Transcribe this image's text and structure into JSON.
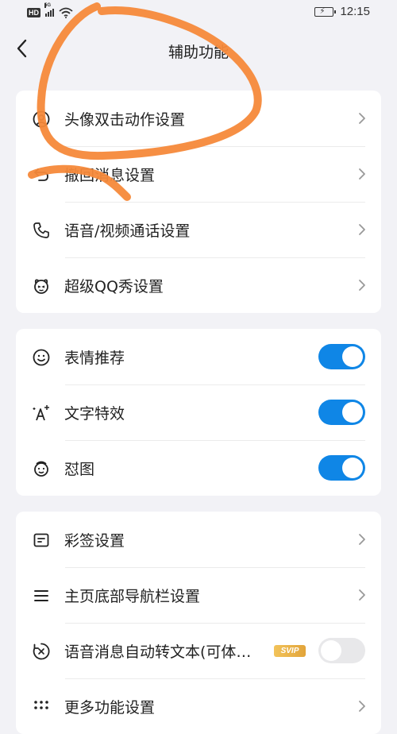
{
  "status_bar": {
    "network_badge": "HD",
    "signal_label": "5G",
    "time": "12:15"
  },
  "nav": {
    "title": "辅助功能"
  },
  "group1": [
    {
      "label": "头像双击动作设置",
      "icon": "avatar-icon"
    },
    {
      "label": "撤回消息设置",
      "icon": "recall-icon"
    },
    {
      "label": "语音/视频通话设置",
      "icon": "phone-icon"
    },
    {
      "label": "超级QQ秀设置",
      "icon": "qqshow-icon"
    }
  ],
  "group2": [
    {
      "label": "表情推荐",
      "icon": "smiley-icon",
      "toggle_on": true
    },
    {
      "label": "文字特效",
      "icon": "text-effect-icon",
      "toggle_on": true
    },
    {
      "label": "怼图",
      "icon": "sticker-icon",
      "toggle_on": true
    }
  ],
  "group3": [
    {
      "label": "彩签设置",
      "icon": "tag-icon"
    },
    {
      "label": "主页底部导航栏设置",
      "icon": "menu-icon"
    },
    {
      "label": "语音消息自动转文本(可体…",
      "icon": "voice-text-icon",
      "badge": "SVIP",
      "toggle_on": false
    },
    {
      "label": "更多功能设置",
      "icon": "more-icon"
    }
  ],
  "colors": {
    "accent": "#0f86e6",
    "annotation": "#f5893a",
    "background": "#f2f2f6"
  }
}
